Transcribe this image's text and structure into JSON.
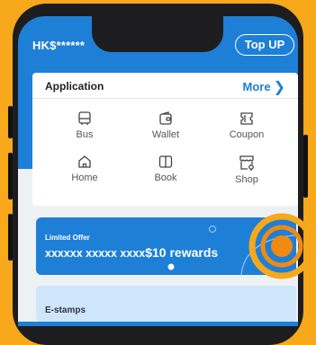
{
  "header": {
    "balance": "HK$******",
    "topup_label": "Top UP"
  },
  "application": {
    "title": "Application",
    "more_label": "More",
    "items": [
      {
        "label": "Bus",
        "icon": "bus-icon"
      },
      {
        "label": "Wallet",
        "icon": "wallet-icon"
      },
      {
        "label": "Coupon",
        "icon": "coupon-icon"
      },
      {
        "label": "Home",
        "icon": "home-icon"
      },
      {
        "label": "Book",
        "icon": "book-icon"
      },
      {
        "label": "Shop",
        "icon": "shop-icon"
      }
    ]
  },
  "offer": {
    "tag": "Limited Offer",
    "text_prefix": "xxxxxx xxxxx xxxx",
    "text_amount": "$10 rewards"
  },
  "estamps": {
    "title": "E-stamps"
  },
  "colors": {
    "background": "#f7a81b",
    "brand_blue": "#1e7fd6",
    "highlight_orange": "#f08a12"
  }
}
